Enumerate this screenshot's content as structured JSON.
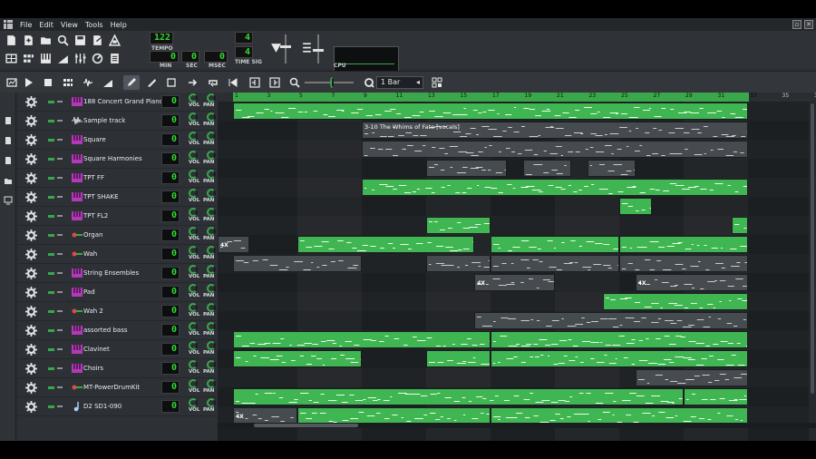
{
  "menu": {
    "items": [
      "File",
      "Edit",
      "View",
      "Tools",
      "Help"
    ]
  },
  "toolbar": {
    "tempo_value": "122",
    "tempo_label": "TEMPO",
    "time_min": "0",
    "time_sec": "0",
    "time_msec": "0",
    "min_label": "MIN",
    "sec_label": "SEC",
    "msec_label": "MSEC",
    "timesig_num": "4",
    "timesig_den": "4",
    "timesig_label": "TIME SIG",
    "cpu_label": "CPU"
  },
  "songeditor": {
    "quantize_value": "1 Bar",
    "bar_numbers": [
      "1",
      "3",
      "5",
      "7",
      "9",
      "11",
      "13",
      "15",
      "17",
      "19",
      "21",
      "23",
      "25",
      "27",
      "29",
      "31",
      "33",
      "35",
      "37"
    ]
  },
  "accent": "#3fb652",
  "tracks": [
    {
      "name": "188 Concert Grand Piano",
      "icon": "instrument-icon",
      "volume": "0"
    },
    {
      "name": "Sample track",
      "icon": "waveform-icon",
      "volume": "0"
    },
    {
      "name": "Square",
      "icon": "instrument-icon",
      "volume": "0"
    },
    {
      "name": "Square Harmonies",
      "icon": "instrument-icon",
      "volume": "0"
    },
    {
      "name": "TPT FF",
      "icon": "instrument-icon",
      "volume": "0"
    },
    {
      "name": "TPT SHAKE",
      "icon": "instrument-icon",
      "volume": "0"
    },
    {
      "name": "TPT FL2",
      "icon": "instrument-icon",
      "volume": "0"
    },
    {
      "name": "Organ",
      "icon": "plugin-icon",
      "volume": "0"
    },
    {
      "name": "Wah",
      "icon": "plugin-icon",
      "volume": "0"
    },
    {
      "name": "String Ensembles",
      "icon": "instrument-icon",
      "volume": "0"
    },
    {
      "name": "Pad",
      "icon": "instrument-icon",
      "volume": "0"
    },
    {
      "name": "Wah 2",
      "icon": "plugin-icon",
      "volume": "0"
    },
    {
      "name": "assorted bass",
      "icon": "instrument-icon",
      "volume": "0"
    },
    {
      "name": "Clavinet",
      "icon": "instrument-icon",
      "volume": "0"
    },
    {
      "name": "Choirs",
      "icon": "instrument-icon",
      "volume": "0"
    },
    {
      "name": "MT-PowerDrumKit",
      "icon": "plugin-icon",
      "volume": "0"
    },
    {
      "name": "D2 SD1-090",
      "icon": "note-icon",
      "volume": "0"
    }
  ],
  "knob_labels": {
    "vol": "VOL",
    "pan": "PAN"
  },
  "sample_clip_title": "3-10 The Whims of Fate [vocals]",
  "clip_x_label": "4X"
}
